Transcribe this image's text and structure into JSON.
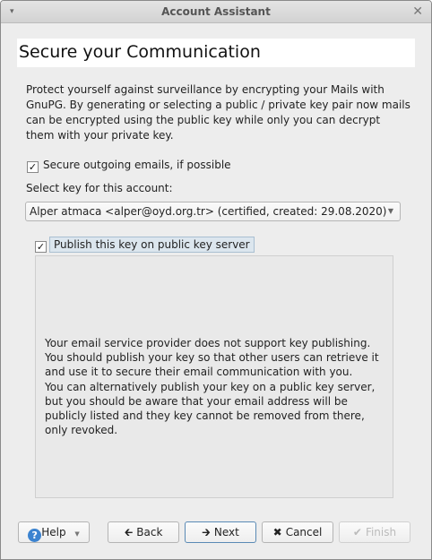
{
  "window": {
    "title": "Account Assistant",
    "menu_icon": "▾",
    "close_icon": "✕"
  },
  "header": {
    "title": "Secure your Communication"
  },
  "intro": "Protect yourself against surveillance by encrypting your Mails with GnuPG. By generating or selecting a public / private key pair now mails can be encrypted using the public key while only you can decrypt them with your private key.",
  "secure_outgoing": {
    "label": "Secure outgoing emails, if possible",
    "checked": true
  },
  "key_select": {
    "label": "Select key for this account:",
    "value": "Alper atmaca <alper@oyd.org.tr> (certified,  created: 29.08.2020)"
  },
  "publish": {
    "label": "Publish this key on public key server",
    "checked": true
  },
  "info": "Your email service provider does not support key publishing. You should publish your key so that other users can retrieve it and use it to secure their email communication with you.\nYou can alternatively publish your key on a public key server, but you should be aware that your email address will be publicly listed and they key cannot be removed from there, only revoked.",
  "buttons": {
    "help": "Help",
    "back": "Back",
    "next": "Next",
    "cancel": "Cancel",
    "finish": "Finish"
  }
}
